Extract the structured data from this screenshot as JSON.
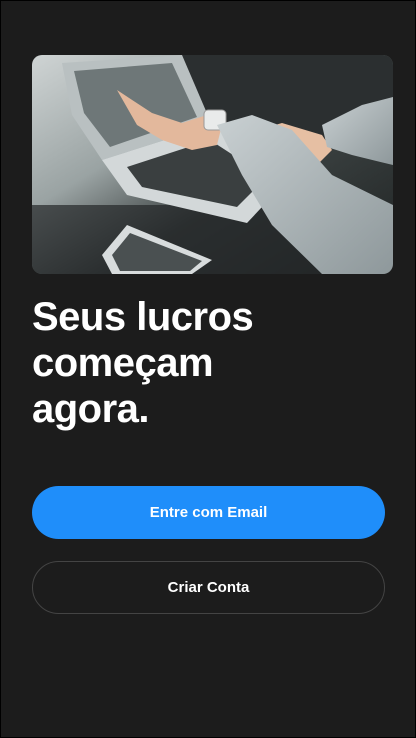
{
  "hero": {
    "image_description": "laptop-typing-photo"
  },
  "headline": {
    "text": "Seus lucros\ncomeçam\nagora."
  },
  "actions": {
    "email_label": "Entre com Email",
    "create_label": "Criar Conta"
  },
  "colors": {
    "background": "#1c1c1c",
    "primary": "#1f8efa",
    "secondary_border": "#444444",
    "text": "#ffffff"
  }
}
